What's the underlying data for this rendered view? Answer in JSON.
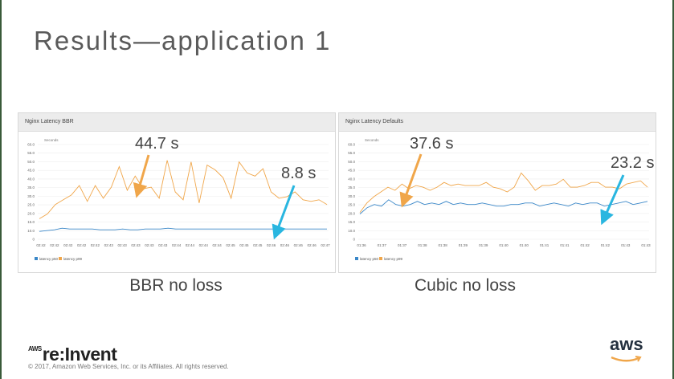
{
  "slide": {
    "title": "Results—application 1",
    "brand_prefix": "AWS",
    "brand_name": "re:Invent",
    "copyright": "© 2017, Amazon Web Services, Inc. or its Affiliates. All rights reserved.",
    "aws_logo_text": "aws",
    "captions": [
      "BBR no loss",
      "Cubic no loss"
    ],
    "callouts_left": [
      "44.7 s",
      "8.8 s"
    ],
    "callouts_right": [
      "37.6 s",
      "23.2 s"
    ],
    "colors": {
      "p50": "#3a87c8",
      "p99": "#f0a64a",
      "arrow_orange": "#f0a64a",
      "arrow_blue": "#29b6e0"
    }
  },
  "chart_data": [
    {
      "type": "line",
      "title": "Nginx Latency BBR",
      "ylabel": "Seconds",
      "ylim": [
        0,
        60
      ],
      "yticks": [
        "0",
        "10.0",
        "15.0",
        "20.0",
        "25.0",
        "30.0",
        "35.0",
        "40.0",
        "45.0",
        "50.0",
        "55.0",
        "60.0"
      ],
      "xticks": [
        "02:42",
        "02:42",
        "02:42",
        "02:42",
        "02:42",
        "02:43",
        "02:43",
        "02:43",
        "02:43",
        "02:43",
        "02:44",
        "02:44",
        "02:44",
        "02:44",
        "02:45",
        "02:45",
        "02:45",
        "02:46",
        "02:46",
        "02:46",
        "02:46",
        "02:47"
      ],
      "legend": [
        "latency p50",
        "latency p99"
      ],
      "series": [
        {
          "name": "latency p50",
          "values": [
            5,
            5.5,
            6,
            7,
            6.5,
            6.5,
            6.5,
            6.5,
            6,
            6,
            6,
            6.5,
            6,
            6,
            6.5,
            6.5,
            6.5,
            7,
            6.5,
            6.5,
            6.5,
            6.5,
            6.5,
            6.5,
            6.5,
            6.5,
            6.5,
            6.5,
            6.5,
            6.5,
            6.5,
            6.5,
            6.5,
            6.5,
            6.5,
            6.5,
            6.5,
            6.5,
            6.5
          ]
        },
        {
          "name": "latency p99",
          "values": [
            13,
            16,
            22,
            25,
            28,
            34,
            24,
            34,
            26,
            33,
            46,
            31,
            40,
            32,
            33,
            26,
            50,
            30,
            25,
            49,
            23,
            47,
            44,
            39,
            26,
            49,
            42,
            40,
            44.7,
            30,
            26,
            27,
            30,
            25,
            24,
            25,
            22
          ]
        }
      ]
    },
    {
      "type": "line",
      "title": "Nginx Latency Defaults",
      "ylabel": "Seconds",
      "ylim": [
        0,
        60
      ],
      "yticks": [
        "0",
        "10.0",
        "15.0",
        "20.0",
        "25.0",
        "30.0",
        "35.0",
        "40.0",
        "45.0",
        "50.0",
        "55.0",
        "60.0"
      ],
      "xticks": [
        "01:36",
        "01:37",
        "01:37",
        "01:38",
        "01:38",
        "01:39",
        "01:39",
        "01:40",
        "01:40",
        "01:41",
        "01:41",
        "01:42",
        "01:42",
        "01:43",
        "01:43"
      ],
      "legend": [
        "latency p50",
        "latency p99"
      ],
      "series": [
        {
          "name": "latency p50",
          "values": [
            16,
            20,
            22,
            21,
            25,
            22,
            21,
            22,
            24,
            22,
            23,
            22,
            24,
            22,
            23,
            22,
            22,
            23,
            22,
            21,
            21,
            22,
            22,
            23,
            23,
            21,
            22,
            23,
            22,
            21,
            23,
            22,
            23,
            23,
            21,
            22,
            23,
            24,
            22,
            23,
            24
          ]
        },
        {
          "name": "latency p99",
          "values": [
            17,
            23,
            27,
            30,
            33,
            31,
            35,
            32,
            34,
            33,
            31,
            33,
            36,
            34,
            35,
            34,
            34,
            34,
            36,
            33,
            32,
            30,
            33,
            42,
            37,
            31,
            34,
            34,
            35,
            38,
            33,
            33,
            34,
            36,
            36,
            33,
            33,
            32,
            35,
            36,
            37,
            33
          ]
        }
      ]
    }
  ]
}
